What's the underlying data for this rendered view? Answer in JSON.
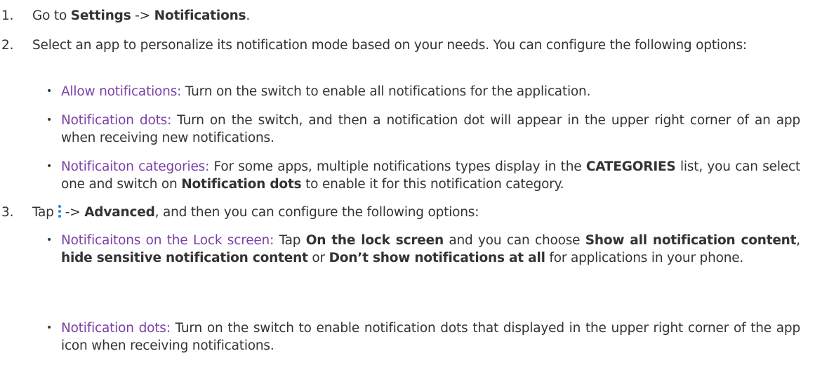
{
  "steps": [
    {
      "number": "1.",
      "pre": "Go to ",
      "settings": "Settings",
      "arrow": " -> ",
      "notifications": "Notifications",
      "end": "."
    },
    {
      "number": "2.",
      "text": "Select an app to personalize its notification mode based on your needs. You can configure the following options:"
    },
    {
      "number": "3.",
      "pre": "Tap",
      "icon": "more-options-icon",
      "arrow": "-> ",
      "advanced": "Advanced",
      "post": ", and then you can configure the following options:"
    }
  ],
  "step2_bullets": [
    {
      "term": "Allow notifications:",
      "text": " Turn on the switch to enable all notifications for the application."
    },
    {
      "term": "Notification dots:",
      "text": " Turn on the switch, and then a notification dot will appear in the upper right corner of an app when receiving new notifications."
    },
    {
      "term": "Notificaiton categories:",
      "text_a": " For some apps, multiple notifications types display in the ",
      "bold_a": "CATEGORIES",
      "text_b": " list, you can select one and switch on ",
      "bold_b": "Notification dots",
      "text_c": " to enable it for this notification category."
    }
  ],
  "step3_bullets": [
    {
      "term": "Notificaitons on the Lock screen:",
      "text_a": " Tap ",
      "bold_a": "On the lock screen",
      "text_b": " and you can choose ",
      "bold_b": "Show all notification content",
      "text_c": ", ",
      "bold_c": "hide sensitive notification content",
      "text_d": " or ",
      "bold_d": "Don’t show notifications at all",
      "text_e": " for applications in your phone."
    },
    {
      "term": "Notification dots:",
      "text": " Turn on the switch to enable notification dots that displayed in the upper right corner of the app icon when receiving notifications."
    }
  ],
  "bullet_glyph": "•",
  "colors": {
    "text": "#333333",
    "term": "#7a3fa8",
    "icon": "#1e88e5"
  }
}
